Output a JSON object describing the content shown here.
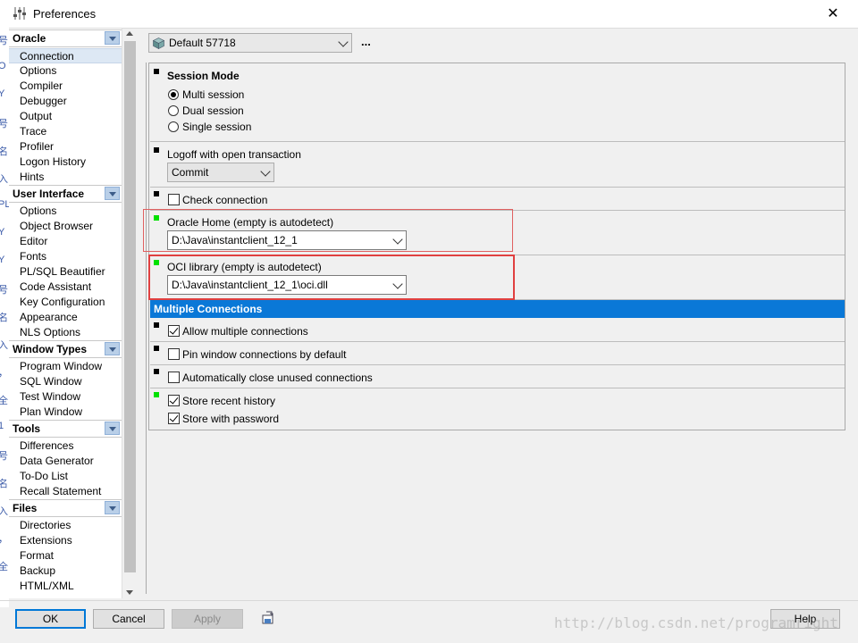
{
  "window": {
    "title": "Preferences",
    "close_glyph": "✕"
  },
  "background_strip": [
    "号",
    "O",
    "Y",
    "号",
    "名",
    "入",
    "PL",
    "Y",
    "Y",
    "号",
    "名",
    "入",
    "，",
    "全",
    "1",
    "号",
    "名",
    "入",
    "，",
    "全"
  ],
  "sidebar": {
    "groups": [
      {
        "label": "Oracle",
        "items": [
          "Connection",
          "Options",
          "Compiler",
          "Debugger",
          "Output",
          "Trace",
          "Profiler",
          "Logon History",
          "Hints"
        ]
      },
      {
        "label": "User Interface",
        "items": [
          "Options",
          "Object Browser",
          "Editor",
          "Fonts",
          "PL/SQL Beautifier",
          "Code Assistant",
          "Key Configuration",
          "Appearance",
          "NLS Options"
        ]
      },
      {
        "label": "Window Types",
        "items": [
          "Program Window",
          "SQL Window",
          "Test Window",
          "Plan Window"
        ]
      },
      {
        "label": "Tools",
        "items": [
          "Differences",
          "Data Generator",
          "To-Do List",
          "Recall Statement"
        ]
      },
      {
        "label": "Files",
        "items": [
          "Directories",
          "Extensions",
          "Format",
          "Backup",
          "HTML/XML"
        ]
      }
    ],
    "selected": "Connection"
  },
  "profile": {
    "label": "Default 57718",
    "more": "..."
  },
  "session_mode": {
    "title": "Session Mode",
    "options": [
      {
        "label": "Multi session",
        "selected": true
      },
      {
        "label": "Dual session",
        "selected": false
      },
      {
        "label": "Single session",
        "selected": false
      }
    ]
  },
  "logoff": {
    "label": "Logoff with open transaction",
    "value": "Commit"
  },
  "check_connection": {
    "label": "Check connection",
    "checked": false
  },
  "oracle_home": {
    "label": "Oracle Home (empty is autodetect)",
    "value": "D:\\Java\\instantclient_12_1"
  },
  "oci_library": {
    "label": "OCI library (empty is autodetect)",
    "value": "D:\\Java\\instantclient_12_1\\oci.dll"
  },
  "multiple_connections": {
    "title": "Multiple Connections",
    "allow": {
      "label": "Allow multiple connections",
      "checked": true
    },
    "pin": {
      "label": "Pin window connections by default",
      "checked": false
    },
    "auto_close": {
      "label": "Automatically close unused connections",
      "checked": false
    },
    "store_history": {
      "label": "Store recent history",
      "checked": true
    },
    "store_password": {
      "label": "Store with password",
      "checked": true
    }
  },
  "buttons": {
    "ok": "OK",
    "cancel": "Cancel",
    "apply": "Apply",
    "help": "Help"
  },
  "watermark": "http://blog.csdn.net/programright",
  "colors": {
    "accent": "#0a78d7",
    "highlight_box": "#e04040",
    "changed_marker": "#00e000"
  }
}
